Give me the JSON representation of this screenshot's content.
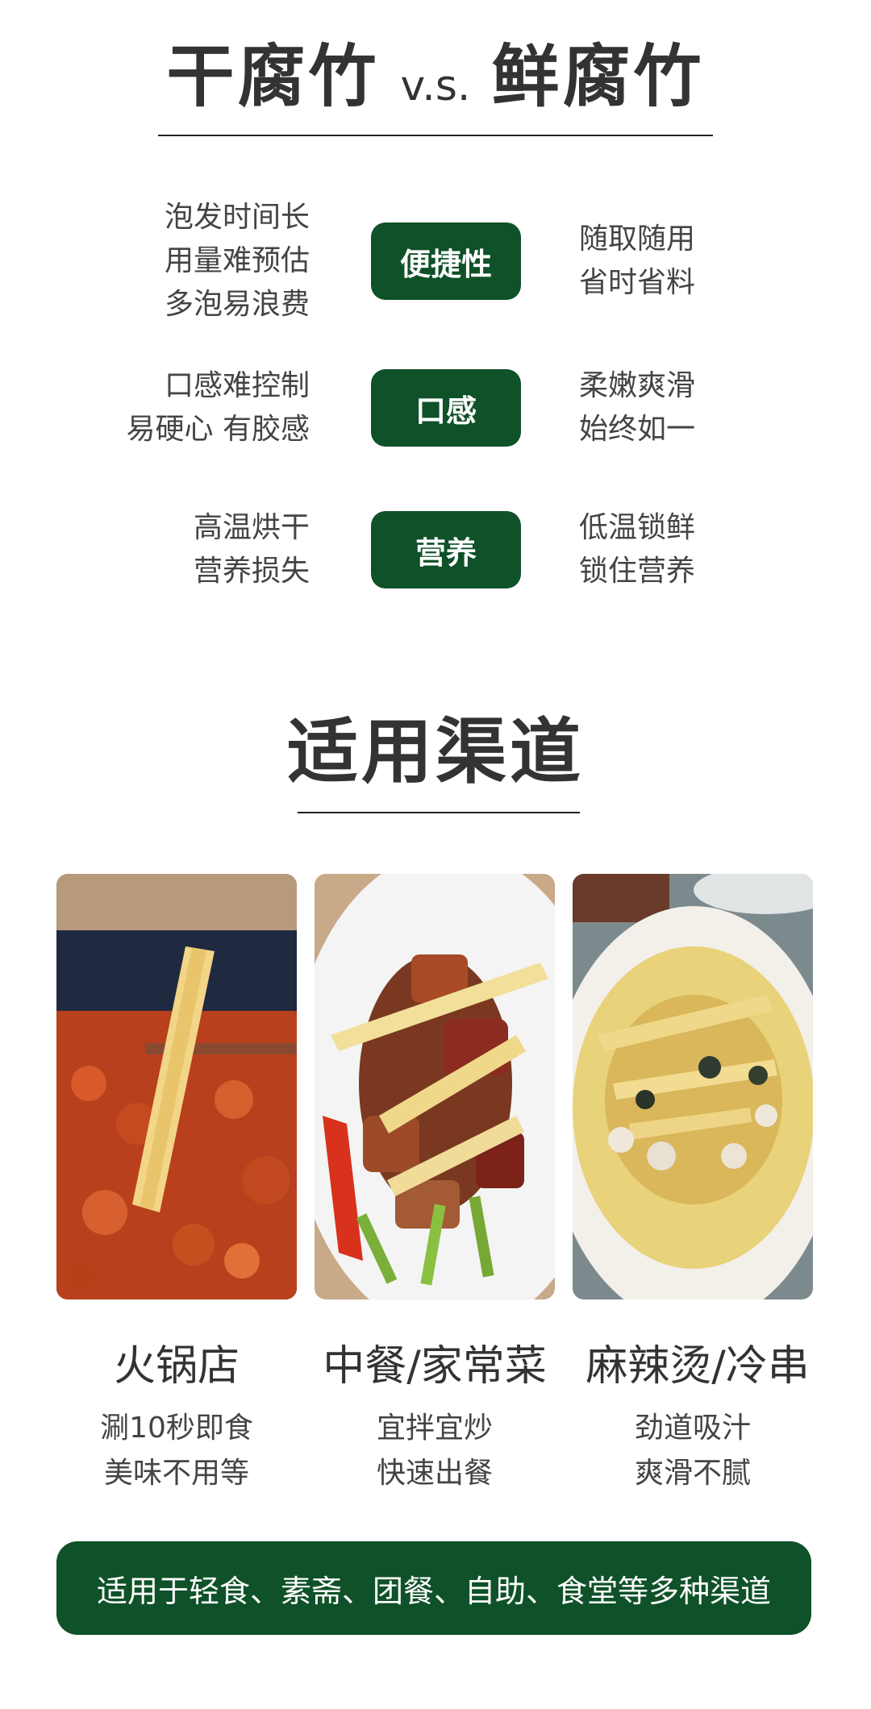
{
  "comparison": {
    "title_left": "干腐竹",
    "title_vs": "v.s.",
    "title_right": "鲜腐竹",
    "rows": [
      {
        "left": [
          "泡发时间长",
          "用量难预估",
          "多泡易浪费"
        ],
        "label": "便捷性",
        "right": [
          "随取随用",
          "省时省料"
        ]
      },
      {
        "left": [
          "口感难控制",
          "易硬心 有胶感"
        ],
        "label": "口感",
        "right": [
          "柔嫩爽滑",
          "始终如一"
        ]
      },
      {
        "left": [
          "高温烘干",
          "营养损失"
        ],
        "label": "营养",
        "right": [
          "低温锁鲜",
          "锁住营养"
        ]
      }
    ]
  },
  "channels": {
    "title": "适用渠道",
    "items": [
      {
        "name": "火锅店",
        "desc": [
          "涮10秒即食",
          "美味不用等"
        ]
      },
      {
        "name": "中餐/家常菜",
        "desc": [
          "宜拌宜炒",
          "快速出餐"
        ]
      },
      {
        "name": "麻辣烫/冷串",
        "desc": [
          "劲道吸汁",
          "爽滑不腻"
        ]
      }
    ],
    "banner": "适用于轻食、素斋、团餐、自助、食堂等多种渠道"
  },
  "colors": {
    "brand_green": "#0f5128",
    "text_dark": "#333333"
  }
}
